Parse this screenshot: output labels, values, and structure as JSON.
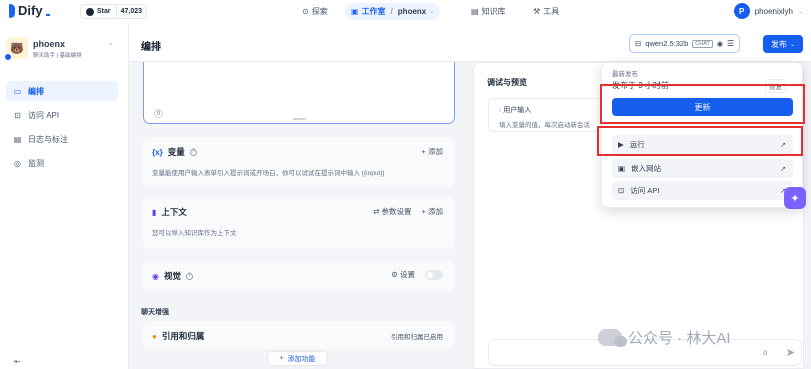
{
  "brand": "Dify",
  "github": {
    "star_label": "Star",
    "count": "47,023"
  },
  "nav": {
    "explore": "探索",
    "studio": "工作室",
    "studio_app": "phoenx",
    "knowledge": "知识库",
    "tools": "工具"
  },
  "user": {
    "avatar_letter": "P",
    "name": "phoenixlyh"
  },
  "app": {
    "name": "phoenx",
    "type": "聊天助手",
    "mode": "基础编排"
  },
  "sidebar": {
    "items": [
      {
        "label": "编排"
      },
      {
        "label": "访问 API"
      },
      {
        "label": "日志与标注"
      },
      {
        "label": "监测"
      }
    ],
    "collapse_icon": "⇤"
  },
  "header": {
    "title": "编排",
    "model_name": "qwen2.5:32b",
    "model_mode": "CHAT",
    "publish_label": "发布"
  },
  "prompt": {
    "char_count": "0"
  },
  "variables": {
    "title": "变量",
    "add_label": "添加",
    "description": "变量能使用户输入表单引入提示词或开场白，你可以试试在提示词中输入 {{input}}"
  },
  "context": {
    "title": "上下文",
    "settings_label": "参数设置",
    "add_label": "添加",
    "description": "您可以导入知识库作为上下文"
  },
  "vision": {
    "title": "视觉",
    "settings_label": "设置"
  },
  "chat_enhance": {
    "section_label": "聊天增强"
  },
  "citation": {
    "title": "引用和归属",
    "status": "引用和归属已启用"
  },
  "add_feature_label": "添加功能",
  "debug": {
    "title": "调试与预览",
    "user_input_title": "用户输入",
    "user_input_desc": "填入变量的值，每次启动新会话",
    "char_count": "0"
  },
  "publish_menu": {
    "latest_label": "最新发布",
    "published_time": "发布于 3 小时前",
    "restore_label": "恢复",
    "update_label": "更新",
    "run_label": "运行",
    "embed_label": "嵌入网站",
    "api_label": "访问 API"
  },
  "watermark": {
    "text": "公众号 · 林大AI"
  },
  "colors": {
    "accent": "#155eef",
    "highlight": "#e5312d"
  }
}
